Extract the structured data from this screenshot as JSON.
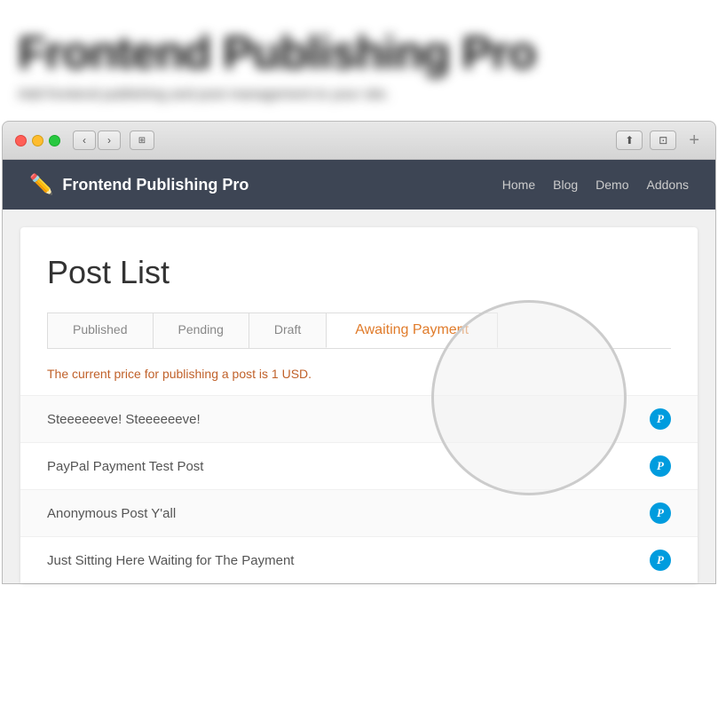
{
  "header": {
    "title": "Frontend Publishing Pro",
    "subtitle": "Add frontend publishing and post management to your site."
  },
  "browser": {
    "back_label": "‹",
    "forward_label": "›",
    "sidebar_label": "⊞",
    "share_label": "⬆",
    "fullscreen_label": "⊡",
    "plus_label": "+"
  },
  "nav": {
    "logo_text": "Frontend Publishing Pro",
    "menu_items": [
      "Home",
      "Blog",
      "Demo",
      "Addons"
    ]
  },
  "post_list": {
    "title": "Post List",
    "tabs": [
      {
        "label": "Published",
        "active": false
      },
      {
        "label": "Pending",
        "active": false
      },
      {
        "label": "Draft",
        "active": false
      },
      {
        "label": "Awaiting Payment",
        "active": true
      }
    ],
    "price_note": "The current price for publishing a post is 1 USD.",
    "posts": [
      {
        "title": "Steeeeeeve! Steeeeeeve!"
      },
      {
        "title": "PayPal Payment Test Post"
      },
      {
        "title": "Anonymous Post Y'all"
      },
      {
        "title": "Just Sitting Here Waiting for The Payment"
      }
    ]
  },
  "colors": {
    "accent": "#e07b2a",
    "nav_bg": "#3d4554",
    "link": "#3a7bbf",
    "paypal_blue": "#009cde"
  }
}
